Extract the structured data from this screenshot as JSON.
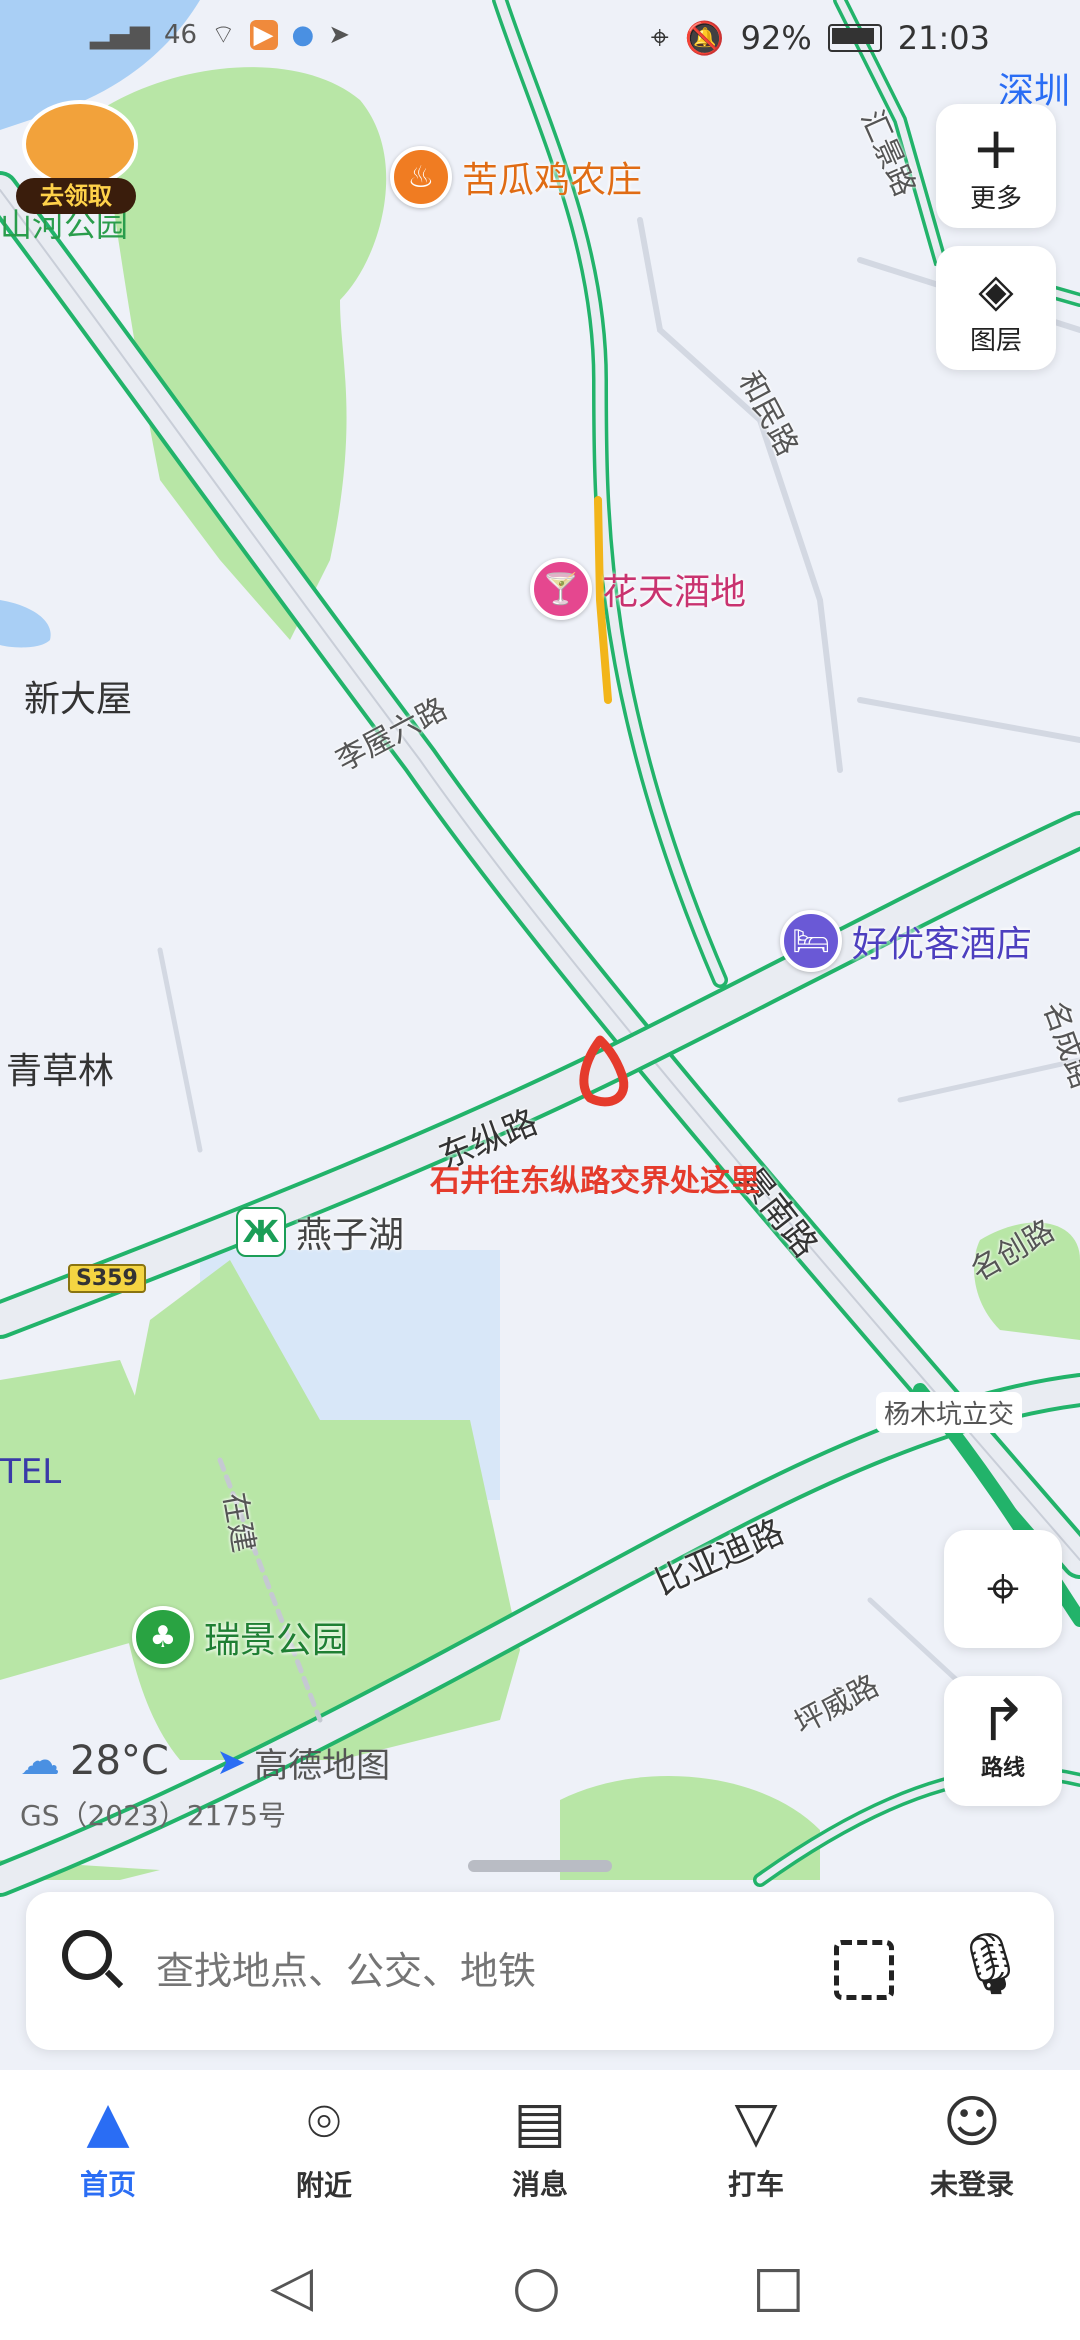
{
  "status_bar": {
    "left_icons": [
      "signal-icon",
      "signal-4g-icon",
      "wifi-icon",
      "app-icon-1",
      "app-icon-2",
      "send-icon"
    ],
    "signal_label": "46",
    "battery": "92%",
    "time": "21:03"
  },
  "map": {
    "places": {
      "xin_da_wu": "新大屋",
      "qing_cao_lin": "青草林",
      "tel": "TEL",
      "shen_zhen": "深圳",
      "park_partial": "山河公园"
    },
    "pois": {
      "kugua": "苦瓜鸡农庄",
      "huatian": "花天酒地",
      "haoyouke": "好优客酒店",
      "yanzihu": "燕子湖",
      "ruijing": "瑞景公园"
    },
    "roads": {
      "liwu6": "李屋六路",
      "dongzong": "东纵路",
      "jing_nan": "景南路",
      "hemin": "和民路",
      "biyadi": "比亚迪路",
      "pingwei": "坪威路",
      "mingchuang1": "名创路",
      "mingchuang2": "名成路",
      "zaijian": "在建",
      "s359": "S359",
      "yangmukeng": "杨木坑立交",
      "top_right_road": "汇景路"
    },
    "annotation": "石井往东纵路交界处这里",
    "promo_badge": "去领取",
    "weather_temp": "28°C",
    "brand": "高德地图",
    "copyright": "GS（2023）2175号"
  },
  "controls": {
    "more_label": "更多",
    "layers_label": "图层",
    "route_label": "路线"
  },
  "search": {
    "placeholder": "查找地点、公交、地铁"
  },
  "tabs": [
    {
      "label": "首页",
      "icon": "navigation-arrow-icon",
      "active": true
    },
    {
      "label": "附近",
      "icon": "location-pin-icon",
      "active": false
    },
    {
      "label": "消息",
      "icon": "message-icon",
      "active": false
    },
    {
      "label": "打车",
      "icon": "taxi-icon",
      "active": false
    },
    {
      "label": "未登录",
      "icon": "user-icon",
      "active": false
    }
  ],
  "colors": {
    "accent": "#2a6df4",
    "road_green": "#22b36a",
    "park_green": "#b8e6a6",
    "water": "#a9cff5",
    "annotation_red": "#e53b2c"
  }
}
